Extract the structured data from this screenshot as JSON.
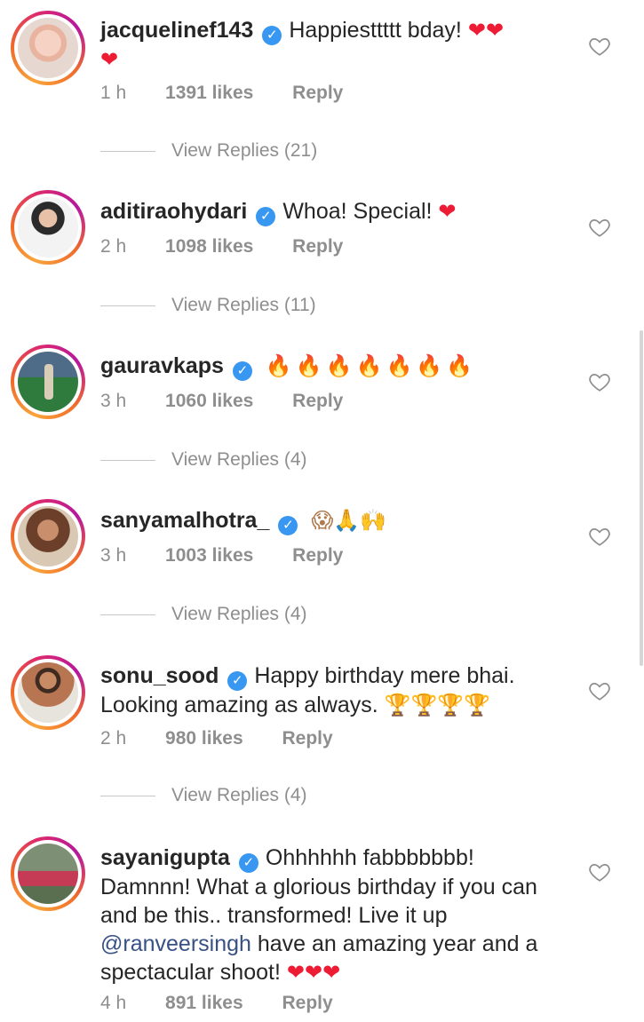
{
  "comments": [
    {
      "username": "jacquelinef143",
      "text": "Happiesttttt bday!",
      "emojis": "❤❤",
      "emojis_line2": "❤",
      "time": "1 h",
      "likes": "1391 likes",
      "reply": "Reply",
      "view_replies": "View Replies (21)"
    },
    {
      "username": "aditiraohydari",
      "text": "Whoa! Special!",
      "emojis": "❤",
      "time": "2 h",
      "likes": "1098 likes",
      "reply": "Reply",
      "view_replies": "View Replies (11)"
    },
    {
      "username": "gauravkaps",
      "text": "",
      "emojis": "🔥🔥🔥🔥🔥🔥🔥",
      "time": "3 h",
      "likes": "1060 likes",
      "reply": "Reply",
      "view_replies": "View Replies (4)"
    },
    {
      "username": "sanyamalhotra_",
      "text": "",
      "emojis": "😱🙏🙌",
      "time": "3 h",
      "likes": "1003 likes",
      "reply": "Reply",
      "view_replies": "View Replies (4)"
    },
    {
      "username": "sonu_sood",
      "text": "Happy birthday mere bhai. Looking amazing as always.",
      "emojis": "🏆🏆🏆🏆",
      "time": "2 h",
      "likes": "980 likes",
      "reply": "Reply",
      "view_replies": "View Replies (4)"
    },
    {
      "username": "sayanigupta",
      "text_part1": "Ohhhhhh fabbbbbbb! Damnnn! What a glorious birthday if you can and be this.. transformed! Live it up",
      "mention": "@ranveersingh",
      "text_part2": "have an amazing year and a spectacular shoot!",
      "emojis": "❤❤❤",
      "time": "4 h",
      "likes": "891 likes",
      "reply": "Reply"
    }
  ],
  "icons": {
    "verified": "verified-badge-icon",
    "like": "heart-outline-icon"
  },
  "colors": {
    "verified_blue": "#3897f0",
    "meta_gray": "#8e8e8e",
    "mention_blue": "#385185",
    "heart_red": "#ed1c34"
  }
}
